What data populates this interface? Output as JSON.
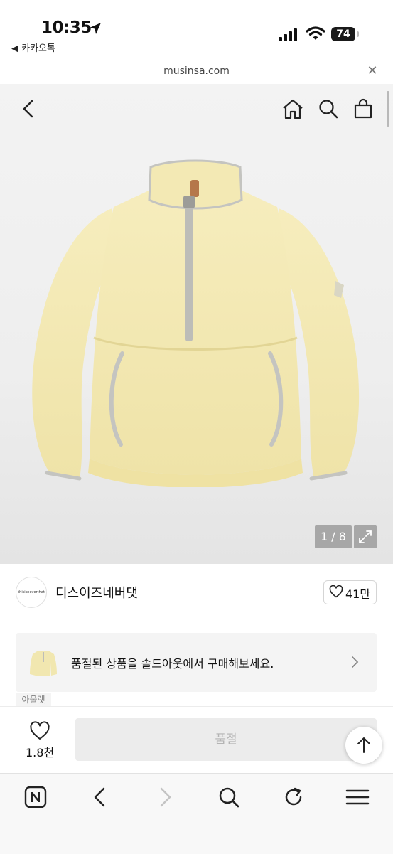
{
  "status_bar": {
    "time": "10:35",
    "back_app": "◀ 카카오톡",
    "battery": "74"
  },
  "browser": {
    "url": "musinsa.com",
    "close_symbol": "✕"
  },
  "product": {
    "image_counter": "1 / 8",
    "image_color": "#f3ebb6",
    "trim_color": "#c4c4c0"
  },
  "brand": {
    "logo_text": "thisisneverthat",
    "name": "디스이즈네버댓",
    "likes": "41만"
  },
  "soldout_banner": {
    "text": "품절된 상품을 솔드아웃에서 구매해보세요.",
    "tag": "아울렛"
  },
  "action_bar": {
    "wish_count": "1.8천",
    "buy_label": "품절"
  },
  "toolbar": {
    "items": [
      "naver-icon",
      "back-icon",
      "forward-icon",
      "search-icon",
      "reload-icon",
      "menu-icon"
    ]
  }
}
